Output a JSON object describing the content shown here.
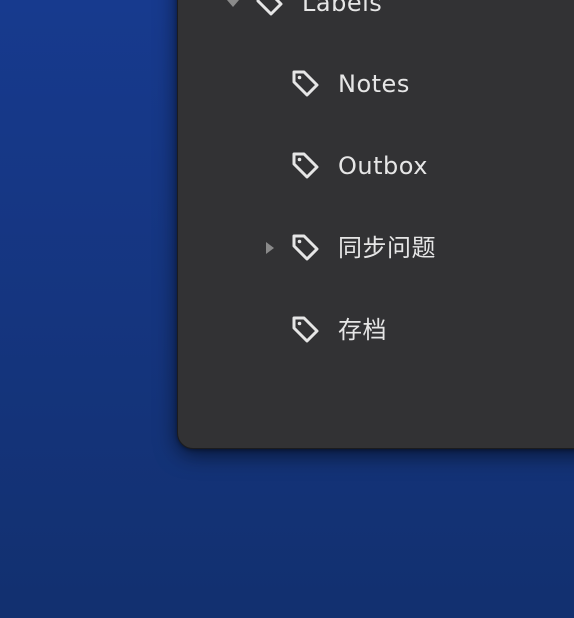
{
  "sidebar": {
    "parent": {
      "label": "Labels",
      "expanded": true
    },
    "items": [
      {
        "label": "Notes",
        "has_children": false
      },
      {
        "label": "Outbox",
        "has_children": false
      },
      {
        "label": "同步问题",
        "has_children": true,
        "expanded": false
      },
      {
        "label": "存档",
        "has_children": false
      }
    ]
  },
  "colors": {
    "desktop": "#15357f",
    "window_bg": "#323234",
    "text": "#e6e6e6",
    "icon": "#e6e6e6",
    "expander": "#8a8a8a"
  },
  "icons": {
    "item_icon": "tag-icon",
    "expander_collapsed": "triangle-right-icon",
    "expander_expanded": "triangle-down-icon"
  }
}
